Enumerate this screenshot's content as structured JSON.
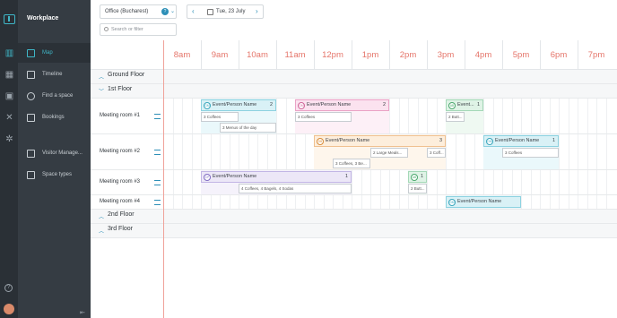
{
  "app": {
    "title": "Workplace"
  },
  "nav": {
    "items": [
      {
        "label": "Map",
        "active": true
      },
      {
        "label": "Timeline"
      },
      {
        "label": "Find a space"
      },
      {
        "label": "Bookings"
      },
      {
        "label": "Visitor Manage..."
      },
      {
        "label": "Space types"
      }
    ]
  },
  "toolbar": {
    "office": "Office (Bucharest)",
    "date": "Tue, 23 July",
    "search_placeholder": "Search or filter"
  },
  "hours": [
    "8am",
    "9am",
    "10am",
    "11am",
    "12pm",
    "1pm",
    "2pm",
    "3pm",
    "4pm",
    "5pm",
    "6pm",
    "7pm"
  ],
  "floors": {
    "ground": "Ground Floor",
    "first": "1st Floor",
    "second": "2nd Floor",
    "third": "3rd Floor"
  },
  "rooms": [
    "Meeting room #1",
    "Meeting room #2",
    "Meeting room #3",
    "Meeting room #4"
  ],
  "events": [
    {
      "room": 0,
      "start": 9.0,
      "end": 11.0,
      "initials": "GM",
      "title": "Event/Person Name",
      "count": "2",
      "color": "cyan"
    },
    {
      "room": 0,
      "start": 11.5,
      "end": 14.0,
      "initials": "GM",
      "title": "Event/Person Name",
      "count": "2",
      "color": "pink"
    },
    {
      "room": 0,
      "start": 15.5,
      "end": 16.5,
      "initials": "AB",
      "title": "Event...",
      "count": "1",
      "color": "green"
    },
    {
      "room": 1,
      "start": 12.0,
      "end": 15.5,
      "initials": "DB",
      "title": "Event/Person Name",
      "count": "3",
      "color": "orange"
    },
    {
      "room": 1,
      "start": 16.5,
      "end": 18.5,
      "initials": "GM",
      "title": "Event/Person Name",
      "count": "1",
      "color": "cyan"
    },
    {
      "room": 2,
      "start": 9.0,
      "end": 13.0,
      "initials": "CP",
      "title": "Event/Person Name",
      "count": "1",
      "color": "purple"
    },
    {
      "room": 2,
      "start": 14.5,
      "end": 15.0,
      "initials": "AB",
      "title": "",
      "count": "1",
      "color": "green"
    },
    {
      "room": 3,
      "start": 15.5,
      "end": 17.5,
      "initials": "GM",
      "title": "Event/Person Name",
      "count": "",
      "color": "cyan"
    }
  ],
  "subitems": [
    {
      "room": 0,
      "row": 0,
      "start": 9.0,
      "end": 10.0,
      "text": "3 Coffees"
    },
    {
      "room": 0,
      "row": 1,
      "start": 9.5,
      "end": 11.0,
      "text": "3 Menus of the day"
    },
    {
      "room": 0,
      "row": 0,
      "start": 11.5,
      "end": 13.0,
      "text": "3 Coffees"
    },
    {
      "room": 0,
      "row": 0,
      "start": 15.5,
      "end": 16.0,
      "text": "2 Butt..."
    },
    {
      "room": 1,
      "row": 0,
      "start": 13.5,
      "end": 14.5,
      "text": "2 Large Meals..."
    },
    {
      "room": 1,
      "row": 1,
      "start": 12.5,
      "end": 13.5,
      "text": "3 Coffees, 3 Be..."
    },
    {
      "room": 1,
      "row": 0,
      "start": 15.0,
      "end": 15.5,
      "text": "3 Coff..."
    },
    {
      "room": 1,
      "row": 0,
      "start": 17.0,
      "end": 18.5,
      "text": "3 Coffees"
    },
    {
      "room": 2,
      "row": 0,
      "start": 10.0,
      "end": 13.0,
      "text": "4 Coffees, 4 Bagels, 4 Sodas"
    },
    {
      "room": 2,
      "row": 0,
      "start": 14.5,
      "end": 15.0,
      "text": "2 Butt..."
    }
  ]
}
